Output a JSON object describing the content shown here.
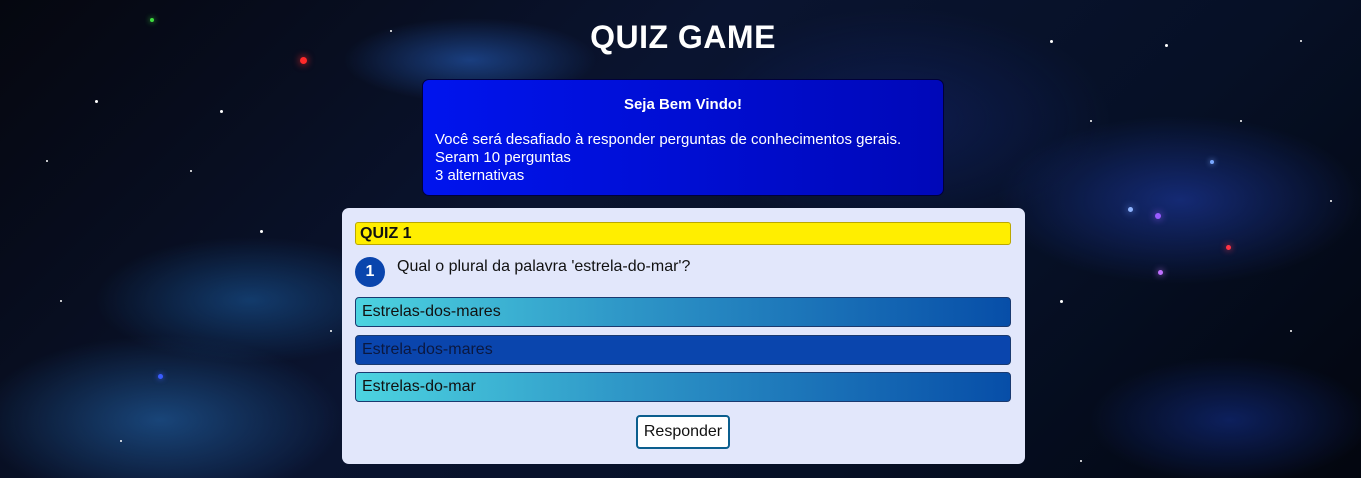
{
  "app": {
    "title": "QUIZ GAME"
  },
  "welcome": {
    "title": "Seja Bem Vindo!",
    "lines": [
      "Você será desafiado à responder perguntas de conhecimentos gerais.",
      "Seram 10 perguntas",
      "3 alternativas"
    ]
  },
  "quiz": {
    "header": "QUIZ 1",
    "question_number": "1",
    "question_text": "Qual o plural da palavra 'estrela-do-mar'?",
    "options": [
      "Estrelas-dos-mares",
      "Estrela-dos-mares",
      "Estrelas-do-mar"
    ],
    "selected_option_index": 1,
    "submit_label": "Responder"
  },
  "colors": {
    "welcome_bg": "#0014ee",
    "quiz_bg": "#e2e7fb",
    "header_bg": "#ffee00",
    "option_selected": "#0a45ad",
    "badge": "#0a45ad"
  }
}
